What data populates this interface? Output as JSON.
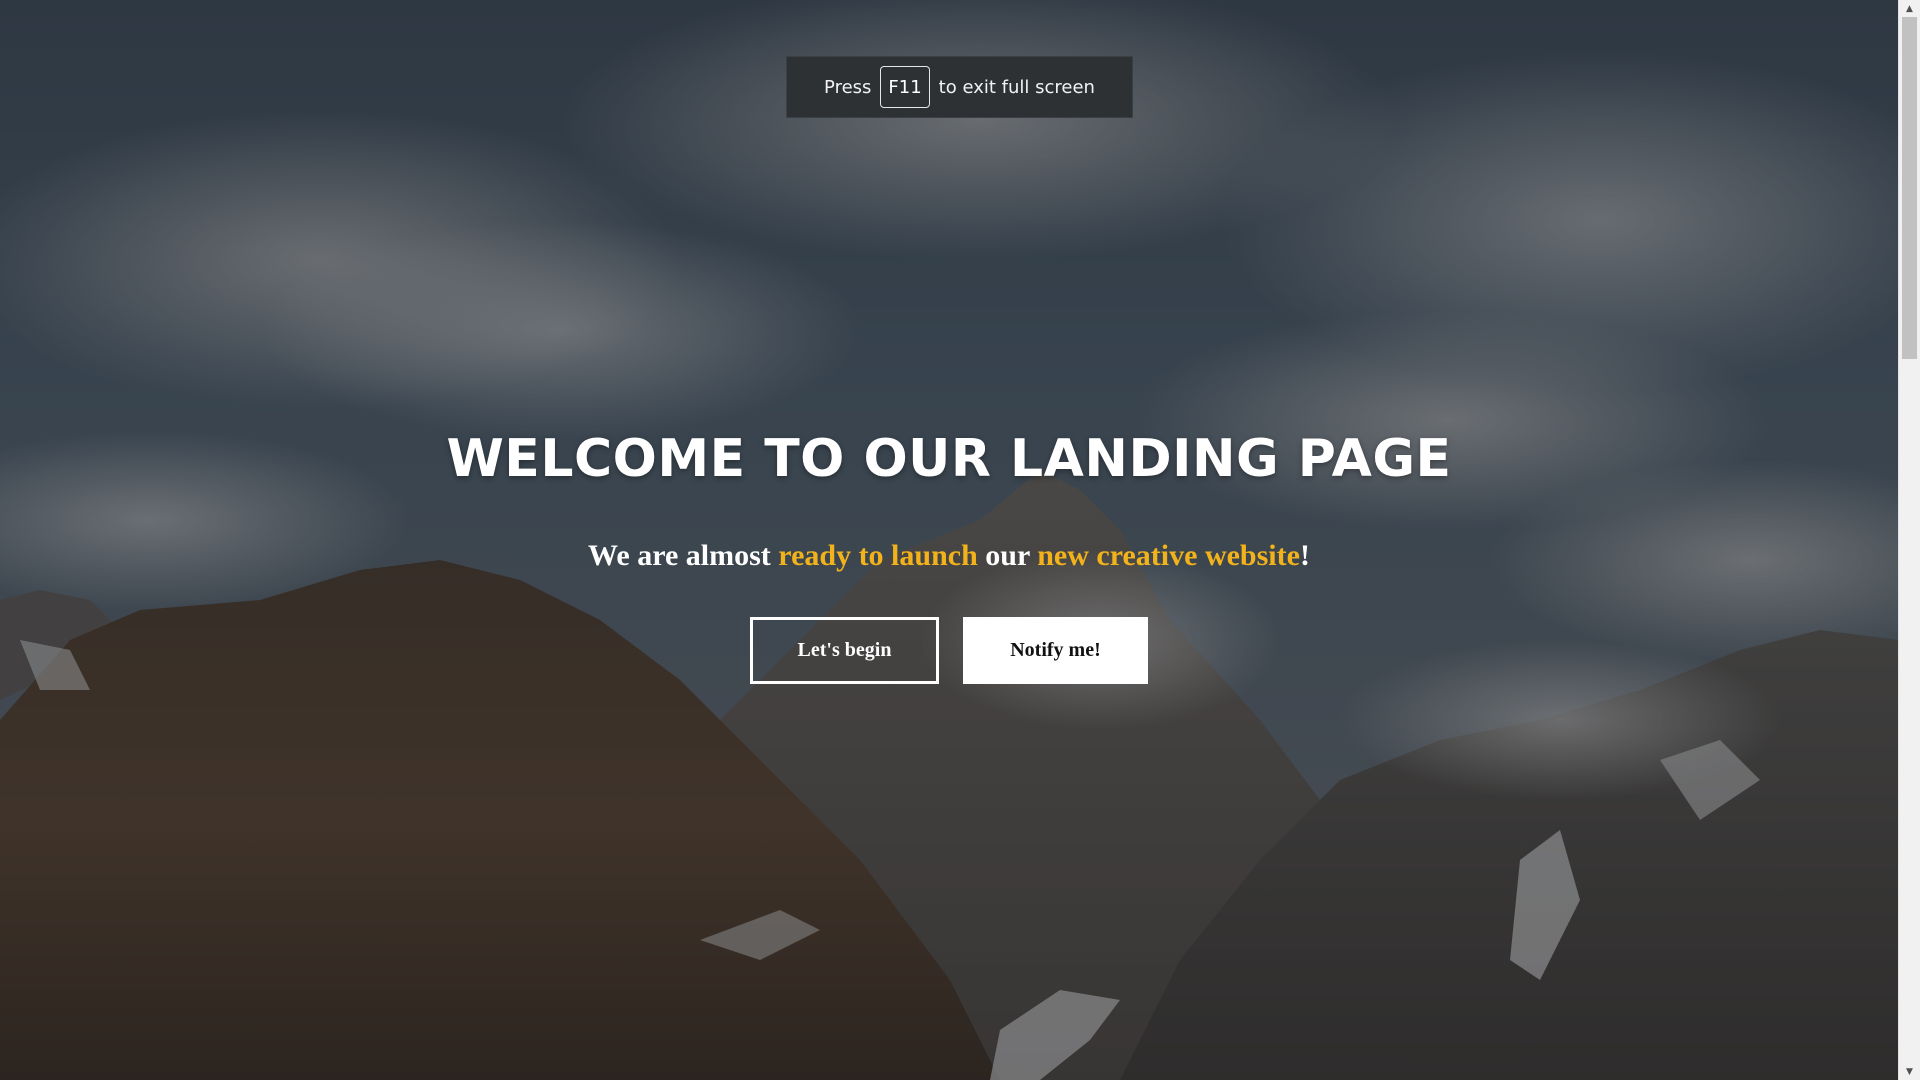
{
  "fullscreen_notice": {
    "prefix": "Press",
    "key": "F11",
    "suffix": "to exit full screen"
  },
  "hero": {
    "title": "WELCOME TO OUR LANDING PAGE",
    "subtitle_parts": {
      "p1": "We are almost ",
      "p2": "ready to launch",
      "p3": " our ",
      "p4": "new creative website",
      "p5": "!"
    },
    "accent_color": "#f2b21b",
    "primary_button_label": "Let's begin",
    "secondary_button_label": "Notify me!"
  },
  "background": {
    "description_icon": "mountain-landscape-image"
  },
  "scrollbar": {
    "up_icon": "triangle-up-icon",
    "down_icon": "triangle-down-icon"
  }
}
